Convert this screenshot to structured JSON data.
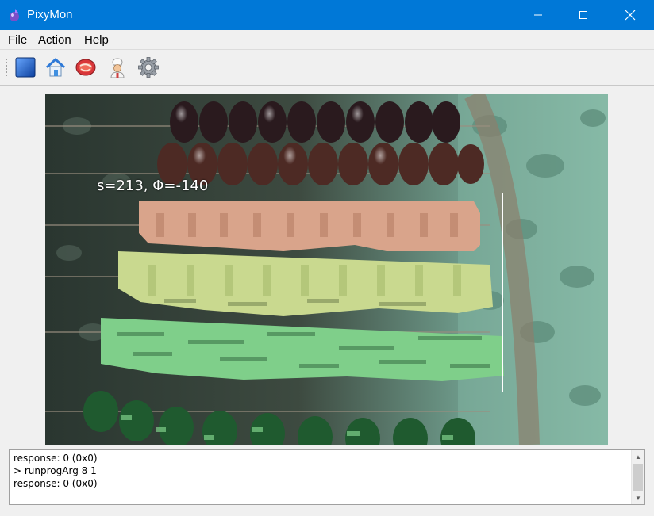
{
  "window": {
    "title": "PixyMon"
  },
  "menu": {
    "items": [
      "File",
      "Action",
      "Help"
    ]
  },
  "toolbar": {
    "icons": [
      "stop-icon",
      "home-icon",
      "meat-icon",
      "chef-icon",
      "gear-icon"
    ]
  },
  "video": {
    "overlay_label": "s=213, Φ=-140"
  },
  "console": {
    "lines": [
      "response: 0 (0x0)",
      "> runprogArg 8 1",
      "response: 0 (0x0)"
    ]
  },
  "colors": {
    "titlebar": "#0078d7",
    "detection_box": "#ffffff",
    "signature_peach": "#d9a48b",
    "signature_lime": "#c9d98f",
    "signature_green": "#7fcf8a"
  }
}
